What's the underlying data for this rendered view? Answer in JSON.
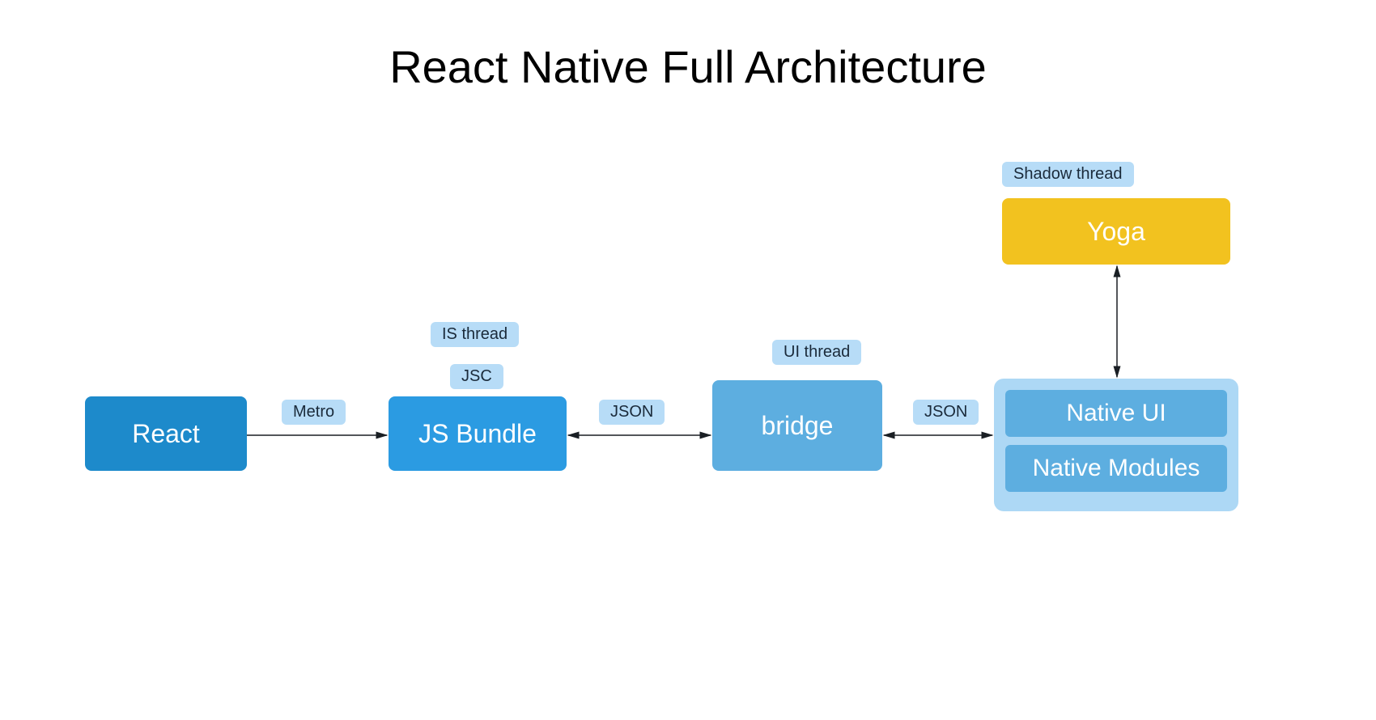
{
  "title": "React Native Full Architecture",
  "nodes": {
    "react": {
      "label": "React",
      "bg": "#1d8acb"
    },
    "jsbundle": {
      "label": "JS Bundle",
      "bg": "#2b9be2"
    },
    "bridge": {
      "label": "bridge",
      "bg": "#5daee0"
    },
    "yoga": {
      "label": "Yoga",
      "bg": "#f2c21f"
    },
    "nativeContainer": {
      "bg": "#add8f5"
    },
    "nativeUI": {
      "label": "Native UI",
      "bg": "#5daee0"
    },
    "nativeModules": {
      "label": "Native Modules",
      "bg": "#5daee0"
    }
  },
  "pills": {
    "metro": {
      "label": "Metro",
      "bg": "#b7dcf7"
    },
    "isThread": {
      "label": "IS thread",
      "bg": "#b7dcf7"
    },
    "jsc": {
      "label": "JSC",
      "bg": "#b7dcf7"
    },
    "json1": {
      "label": "JSON",
      "bg": "#b7dcf7"
    },
    "uiThread": {
      "label": "UI thread",
      "bg": "#b7dcf7"
    },
    "json2": {
      "label": "JSON",
      "bg": "#b7dcf7"
    },
    "shadowThread": {
      "label": "Shadow thread",
      "bg": "#b7dcf7"
    }
  },
  "colors": {
    "arrow": "#1a1f24"
  }
}
